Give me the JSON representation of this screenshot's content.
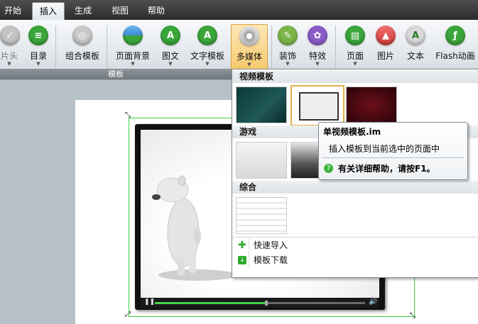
{
  "menubar": {
    "tabs": [
      "开始",
      "插入",
      "生成",
      "视图",
      "帮助"
    ],
    "active": "插入"
  },
  "ribbon": {
    "buttons": [
      {
        "label": "片头",
        "icon": "intro-icon",
        "color": "#bdbdbd"
      },
      {
        "label": "目录",
        "icon": "toc-icon",
        "color": "#3aa63a"
      },
      {
        "label": "组合模板",
        "icon": "combo-template-icon",
        "color": "#c8c8c8"
      },
      {
        "label": "页面背景",
        "icon": "page-background-icon",
        "color": "#3d8cd1"
      },
      {
        "label": "图文",
        "icon": "image-text-icon",
        "color": "#3aa63a"
      },
      {
        "label": "文字模板",
        "icon": "text-template-icon",
        "color": "#3aa63a"
      },
      {
        "label": "多媒体",
        "icon": "multimedia-icon",
        "color": "#c0c0c0"
      },
      {
        "label": "装饰",
        "icon": "decoration-icon",
        "color": "#7ab648"
      },
      {
        "label": "特效",
        "icon": "effects-icon",
        "color": "#8a5cc7"
      },
      {
        "label": "页面",
        "icon": "page-icon",
        "color": "#3aa63a"
      },
      {
        "label": "图片",
        "icon": "picture-icon",
        "color": "#d23b3b"
      },
      {
        "label": "文本",
        "icon": "text-icon",
        "color": "#bfbfbf"
      },
      {
        "label": "Flash动画",
        "icon": "flash-icon",
        "color": "#3aa63a"
      }
    ],
    "group_label": "模板"
  },
  "dropdown": {
    "sections": [
      {
        "title": "视频模板"
      },
      {
        "title": "游戏"
      },
      {
        "title": "综合"
      }
    ],
    "items": [
      {
        "label": "快速导入",
        "icon": "plus-icon"
      },
      {
        "label": "模板下载",
        "icon": "download-icon"
      }
    ]
  },
  "tooltip": {
    "title": "单视频模板.im",
    "description": "插入模板到当前选中的页面中",
    "help": "有关详细帮助，请按F1。"
  },
  "player": {
    "progress": 0.53
  }
}
